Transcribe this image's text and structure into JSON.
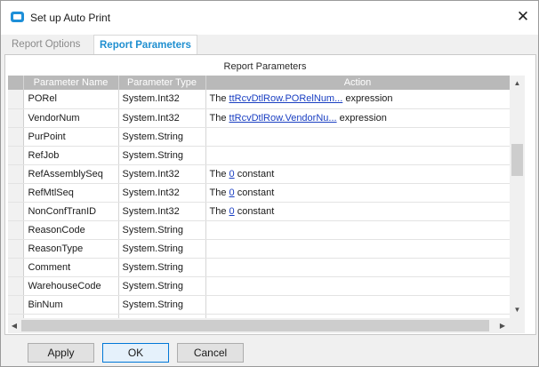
{
  "window": {
    "title": "Set up Auto Print"
  },
  "tabs": [
    {
      "label": "Report Options",
      "active": false
    },
    {
      "label": "Report Parameters",
      "active": true
    }
  ],
  "grid": {
    "caption": "Report Parameters",
    "columns": [
      "Parameter Name",
      "Parameter Type",
      "Action"
    ],
    "rows": [
      {
        "name": "PORel",
        "type": "System.Int32",
        "action_prefix": "The ",
        "action_link": "ttRcvDtlRow.PORelNum...",
        "action_suffix": " expression"
      },
      {
        "name": "VendorNum",
        "type": "System.Int32",
        "action_prefix": "The ",
        "action_link": "ttRcvDtlRow.VendorNu...",
        "action_suffix": " expression"
      },
      {
        "name": "PurPoint",
        "type": "System.String",
        "action_prefix": "",
        "action_link": "",
        "action_suffix": ""
      },
      {
        "name": "RefJob",
        "type": "System.String",
        "action_prefix": "",
        "action_link": "",
        "action_suffix": ""
      },
      {
        "name": "RefAssemblySeq",
        "type": "System.Int32",
        "action_prefix": "The ",
        "action_link": "0",
        "action_suffix": " constant"
      },
      {
        "name": "RefMtlSeq",
        "type": "System.Int32",
        "action_prefix": "The ",
        "action_link": "0",
        "action_suffix": " constant"
      },
      {
        "name": "NonConfTranID",
        "type": "System.Int32",
        "action_prefix": "The ",
        "action_link": "0",
        "action_suffix": " constant"
      },
      {
        "name": "ReasonCode",
        "type": "System.String",
        "action_prefix": "",
        "action_link": "",
        "action_suffix": ""
      },
      {
        "name": "ReasonType",
        "type": "System.String",
        "action_prefix": "",
        "action_link": "",
        "action_suffix": ""
      },
      {
        "name": "Comment",
        "type": "System.String",
        "action_prefix": "",
        "action_link": "",
        "action_suffix": ""
      },
      {
        "name": "WarehouseCode",
        "type": "System.String",
        "action_prefix": "",
        "action_link": "",
        "action_suffix": ""
      },
      {
        "name": "BinNum",
        "type": "System.String",
        "action_prefix": "",
        "action_link": "",
        "action_suffix": ""
      },
      {
        "name": "",
        "type": "",
        "action_prefix": "",
        "action_link": "",
        "action_suffix": ""
      }
    ]
  },
  "buttons": {
    "apply": "Apply",
    "ok": "OK",
    "cancel": "Cancel"
  },
  "icons": {
    "app": "app-window-icon",
    "close": "close-icon"
  },
  "colors": {
    "accent": "#1f8fd0",
    "link": "#1a3fc2",
    "header_bg": "#b9b9b9",
    "ok_border": "#0078d7"
  }
}
